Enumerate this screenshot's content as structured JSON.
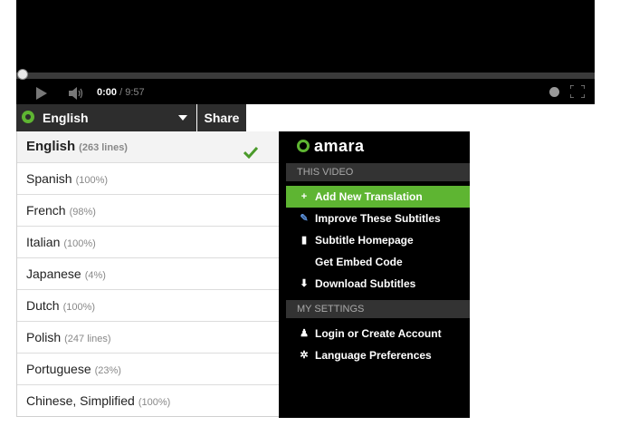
{
  "player": {
    "current_time": "0:00",
    "separator": " / ",
    "duration": "9:57",
    "progress": 0
  },
  "language_tab": {
    "label": "English"
  },
  "share_tab": {
    "label": "Share"
  },
  "languages": [
    {
      "name": "English",
      "meta": "(263 lines)",
      "selected": true
    },
    {
      "name": "Spanish",
      "meta": "(100%)"
    },
    {
      "name": "French",
      "meta": "(98%)"
    },
    {
      "name": "Italian",
      "meta": "(100%)"
    },
    {
      "name": "Japanese",
      "meta": "(4%)"
    },
    {
      "name": "Dutch",
      "meta": "(100%)"
    },
    {
      "name": "Polish",
      "meta": "(247 lines)"
    },
    {
      "name": "Portuguese",
      "meta": "(23%)"
    },
    {
      "name": "Chinese, Simplified",
      "meta": "(100%)"
    }
  ],
  "amara": {
    "logo_text": "amara",
    "this_video_heading": "THIS VIDEO",
    "this_video_items": [
      {
        "label": "Add New Translation",
        "icon": "+"
      },
      {
        "label": "Improve These Subtitles",
        "icon": "✎"
      },
      {
        "label": "Subtitle Homepage",
        "icon": "▮"
      },
      {
        "label": "Get Embed Code",
        "icon": ""
      },
      {
        "label": "Download Subtitles",
        "icon": "⬇"
      }
    ],
    "settings_heading": "MY SETTINGS",
    "settings_items": [
      {
        "label": "Login or Create Account",
        "icon": "♟"
      },
      {
        "label": "Language Preferences",
        "icon": "✲"
      }
    ]
  },
  "colors": {
    "accent": "#5eb532",
    "panel": "#2d2d2d",
    "menu_bg": "#000000"
  }
}
